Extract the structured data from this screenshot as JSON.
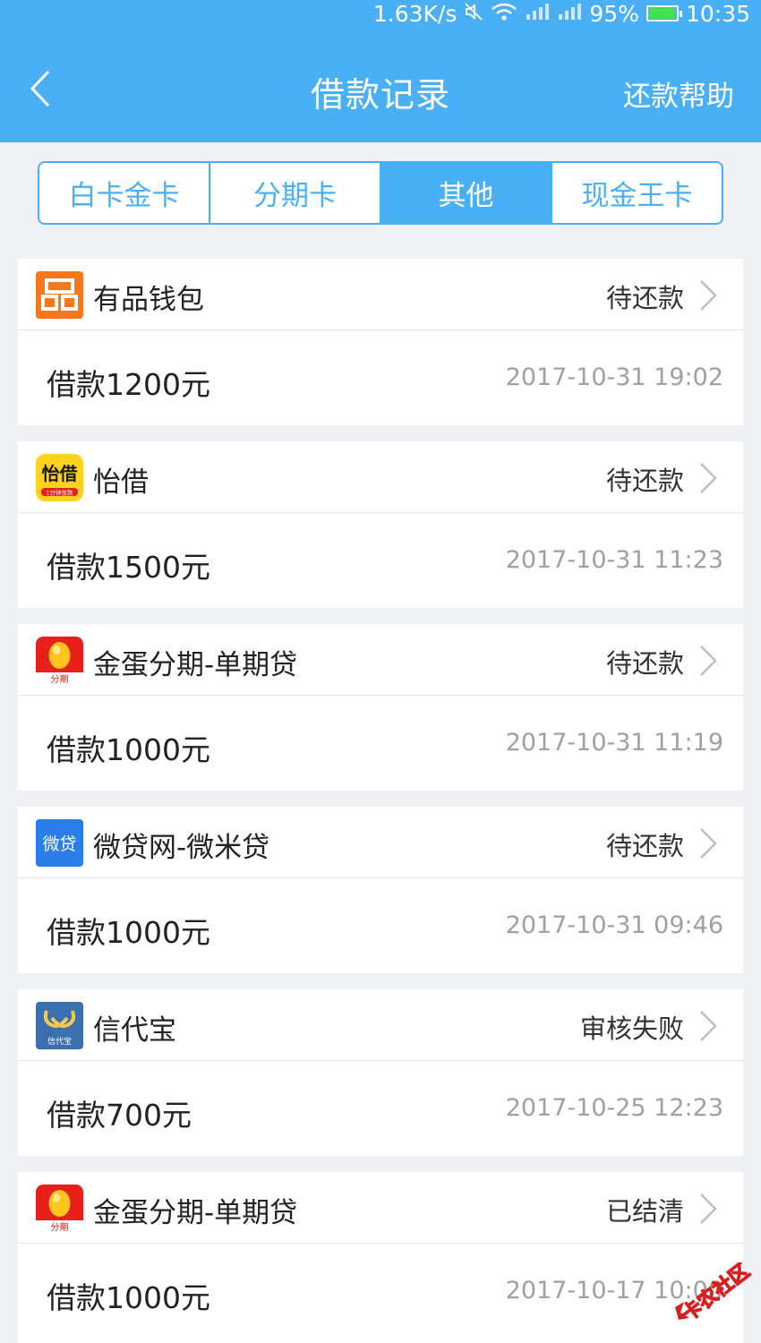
{
  "status_bar": {
    "speed": "1.63K/s",
    "battery": "95%",
    "battery_level": 0.95,
    "time": "10:35"
  },
  "header": {
    "title": "借款记录",
    "help": "还款帮助"
  },
  "tabs": [
    {
      "label": "白卡金卡",
      "active": false
    },
    {
      "label": "分期卡",
      "active": false
    },
    {
      "label": "其他",
      "active": true
    },
    {
      "label": "现金王卡",
      "active": false
    }
  ],
  "records": [
    {
      "name": "有品钱包",
      "status": "待还款",
      "amount": "借款1200元",
      "time": "2017-10-31 19:02",
      "logo_icon": "youpin-wallet-logo",
      "logo_color": "#f5781f"
    },
    {
      "name": "怡借",
      "status": "待还款",
      "amount": "借款1500元",
      "time": "2017-10-31 11:23",
      "logo_icon": "yijie-logo",
      "logo_color": "#ffd21e",
      "logo_text": "怡借",
      "logo_subtext": "1分钟放款"
    },
    {
      "name": "金蛋分期-单期贷",
      "status": "待还款",
      "amount": "借款1000元",
      "time": "2017-10-31 11:19",
      "logo_icon": "golden-egg-logo",
      "logo_color": "#e8201c",
      "logo_text": "分期"
    },
    {
      "name": "微贷网-微米贷",
      "status": "待还款",
      "amount": "借款1000元",
      "time": "2017-10-31 09:46",
      "logo_icon": "weidai-logo",
      "logo_color": "#2b7de9",
      "logo_text": "微贷"
    },
    {
      "name": "信代宝",
      "status": "审核失败",
      "amount": "借款700元",
      "time": "2017-10-25 12:23",
      "logo_icon": "xindaibao-logo",
      "logo_color": "#3b6fb0",
      "logo_text": "信代宝"
    },
    {
      "name": "金蛋分期-单期贷",
      "status": "已结清",
      "amount": "借款1000元",
      "time": "2017-10-17 10:00",
      "logo_icon": "golden-egg-logo",
      "logo_color": "#e8201c",
      "logo_text": "分期"
    }
  ],
  "watermark": {
    "text": "卡农社区"
  }
}
